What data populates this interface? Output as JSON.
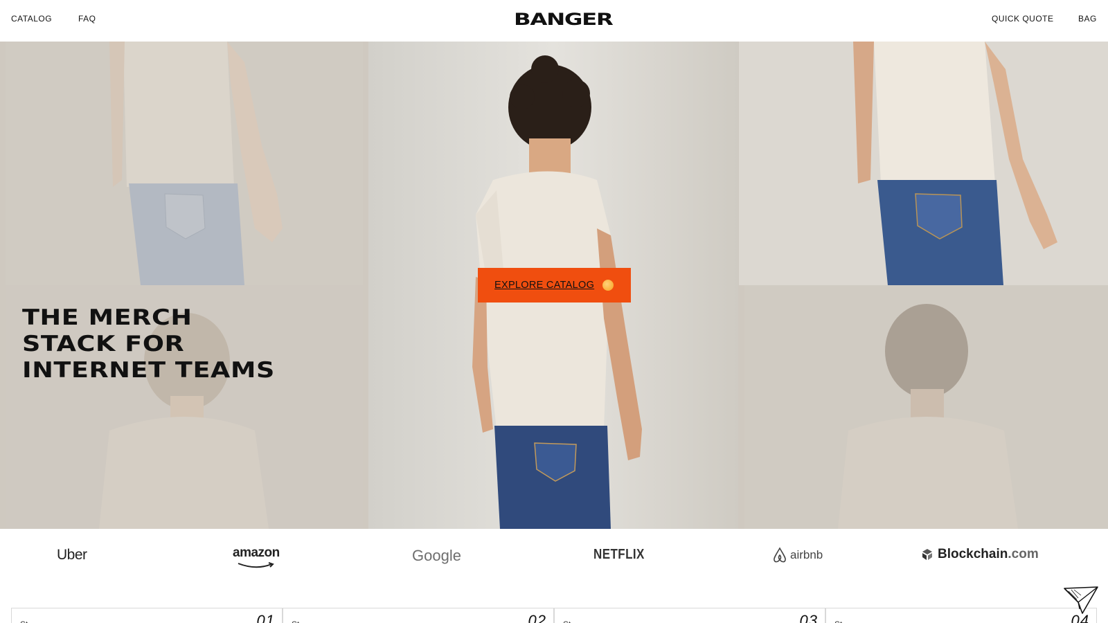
{
  "header": {
    "nav_left": [
      "CATALOG",
      "FAQ"
    ],
    "logo": "BANGER",
    "nav_right": [
      "QUICK QUOTE",
      "BAG"
    ]
  },
  "hero": {
    "title_lines": [
      "THE MERCH",
      "STACK FOR",
      "INTERNET TEAMS"
    ],
    "cta_label": "EXPLORE CATALOG"
  },
  "brands": {
    "uber": "Uber",
    "amazon": "amazon",
    "google": "Google",
    "netflix": "NETFLIX",
    "airbnb": "airbnb",
    "blockchain_name": "Blockchain",
    "blockchain_domain": ".com"
  },
  "cards": [
    {
      "label": "St",
      "number": "01"
    },
    {
      "label": "St",
      "number": "02"
    },
    {
      "label": "St",
      "number": "03"
    },
    {
      "label": "St",
      "number": "04"
    }
  ],
  "colors": {
    "accent": "#f04e0f",
    "cta_dot": "#f7a21f",
    "text": "#111111"
  },
  "icons": {
    "paper_plane": "paper-plane-icon",
    "airbnb": "airbnb-icon",
    "blockchain": "blockchain-icon",
    "cta_dot": "orange-dot-icon"
  }
}
